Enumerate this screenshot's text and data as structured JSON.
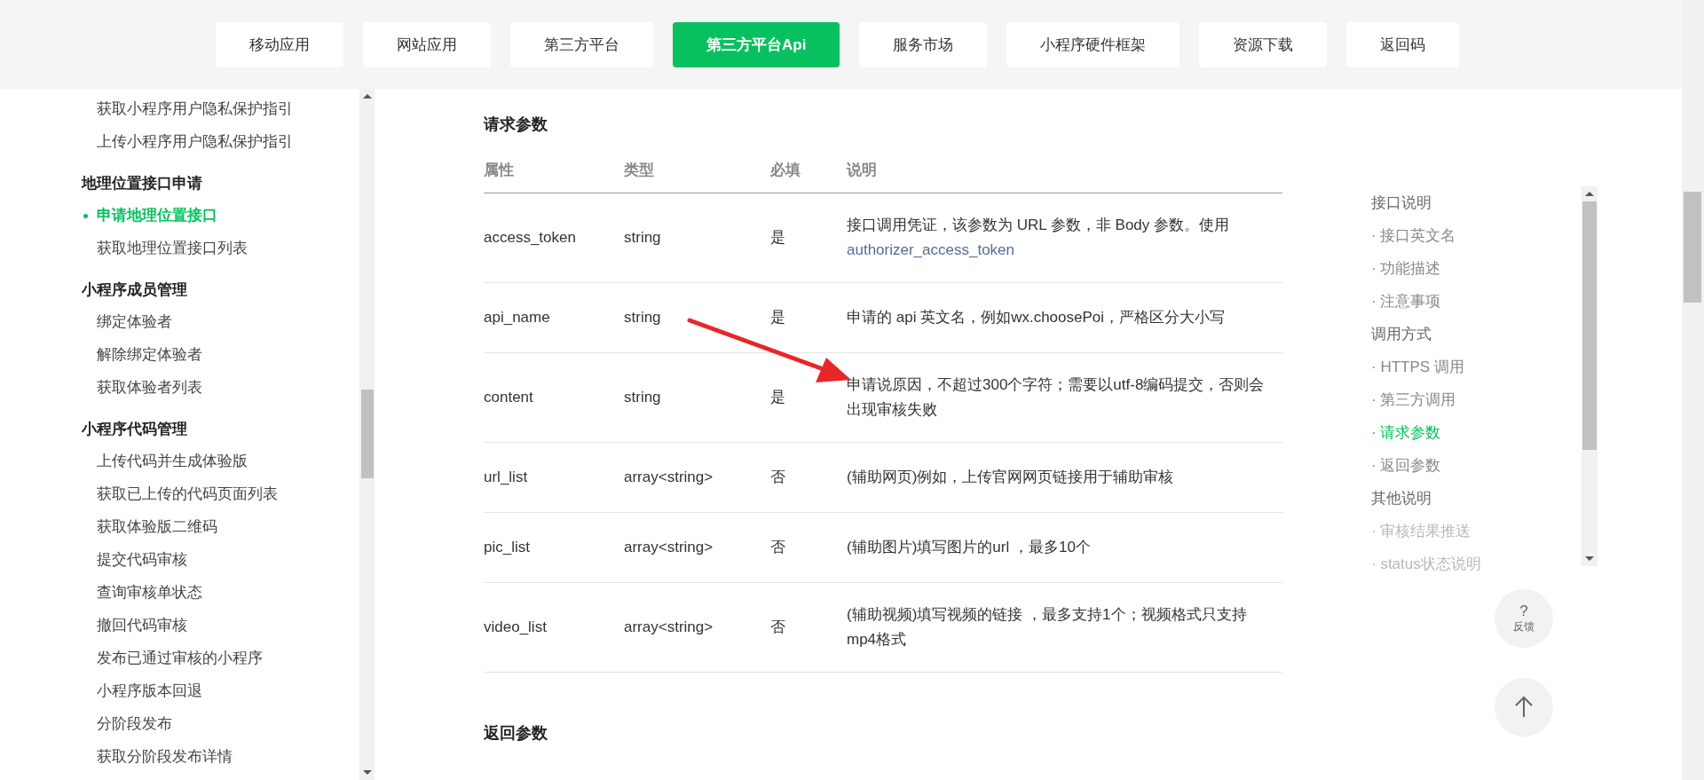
{
  "top_nav": [
    {
      "label": "移动应用",
      "selected": false
    },
    {
      "label": "网站应用",
      "selected": false
    },
    {
      "label": "第三方平台",
      "selected": false
    },
    {
      "label": "第三方平台Api",
      "selected": true
    },
    {
      "label": "服务市场",
      "selected": false
    },
    {
      "label": "小程序硬件框架",
      "selected": false
    },
    {
      "label": "资源下载",
      "selected": false
    },
    {
      "label": "返回码",
      "selected": false
    }
  ],
  "sidebar": {
    "groups": [
      {
        "items": [
          {
            "label": "获取小程序用户隐私保护指引",
            "selected": false
          },
          {
            "label": "上传小程序用户隐私保护指引",
            "selected": false
          }
        ]
      },
      {
        "title": "地理位置接口申请",
        "items": [
          {
            "label": "申请地理位置接口",
            "selected": true
          },
          {
            "label": "获取地理位置接口列表",
            "selected": false
          }
        ]
      },
      {
        "title": "小程序成员管理",
        "items": [
          {
            "label": "绑定体验者",
            "selected": false
          },
          {
            "label": "解除绑定体验者",
            "selected": false
          },
          {
            "label": "获取体验者列表",
            "selected": false
          }
        ]
      },
      {
        "title": "小程序代码管理",
        "items": [
          {
            "label": "上传代码并生成体验版",
            "selected": false
          },
          {
            "label": "获取已上传的代码页面列表",
            "selected": false
          },
          {
            "label": "获取体验版二维码",
            "selected": false
          },
          {
            "label": "提交代码审核",
            "selected": false
          },
          {
            "label": "查询审核单状态",
            "selected": false
          },
          {
            "label": "撤回代码审核",
            "selected": false
          },
          {
            "label": "发布已通过审核的小程序",
            "selected": false
          },
          {
            "label": "小程序版本回退",
            "selected": false
          },
          {
            "label": "分阶段发布",
            "selected": false
          },
          {
            "label": "获取分阶段发布详情",
            "selected": false
          }
        ]
      }
    ]
  },
  "content": {
    "heading": "请求参数",
    "table": {
      "columns": [
        "属性",
        "类型",
        "必填",
        "说明"
      ],
      "rows": [
        {
          "name": "access_token",
          "type": "string",
          "required": "是",
          "description": "接口调用凭证，该参数为 URL 参数，非 Body 参数。使用",
          "link": "authorizer_access_token"
        },
        {
          "name": "api_name",
          "type": "string",
          "required": "是",
          "description": "申请的 api 英文名，例如wx.choosePoi，严格区分大小写"
        },
        {
          "name": "content",
          "type": "string",
          "required": "是",
          "description": "申请说原因，不超过300个字符；需要以utf-8编码提交，否则会出现审核失败"
        },
        {
          "name": "url_list",
          "type": "array<string>",
          "required": "否",
          "description": "(辅助网页)例如，上传官网网页链接用于辅助审核"
        },
        {
          "name": "pic_list",
          "type": "array<string>",
          "required": "否",
          "description": "(辅助图片)填写图片的url ，最多10个"
        },
        {
          "name": "video_list",
          "type": "array<string>",
          "required": "否",
          "description": "(辅助视频)填写视频的链接 ，最多支持1个；视频格式只支持mp4格式"
        }
      ]
    },
    "next_heading": "返回参数"
  },
  "toc": [
    {
      "kind": "section",
      "label": "接口说明",
      "selected": false
    },
    {
      "kind": "item",
      "label": "· 接口英文名",
      "selected": false
    },
    {
      "kind": "item",
      "label": "· 功能描述",
      "selected": false
    },
    {
      "kind": "item",
      "label": "· 注意事项",
      "selected": false
    },
    {
      "kind": "section",
      "label": "调用方式",
      "selected": false
    },
    {
      "kind": "item",
      "label": "· HTTPS 调用",
      "selected": false
    },
    {
      "kind": "item",
      "label": "· 第三方调用",
      "selected": false
    },
    {
      "kind": "item",
      "label": "· 请求参数",
      "selected": true
    },
    {
      "kind": "item",
      "label": "· 返回参数",
      "selected": false
    },
    {
      "kind": "section",
      "label": "其他说明",
      "selected": false
    },
    {
      "kind": "item",
      "label": "· 审核结果推送",
      "selected": false
    },
    {
      "kind": "item",
      "label": "· status状态说明",
      "selected": false
    }
  ],
  "feedback": {
    "symbol": "?",
    "label": "反馈"
  }
}
